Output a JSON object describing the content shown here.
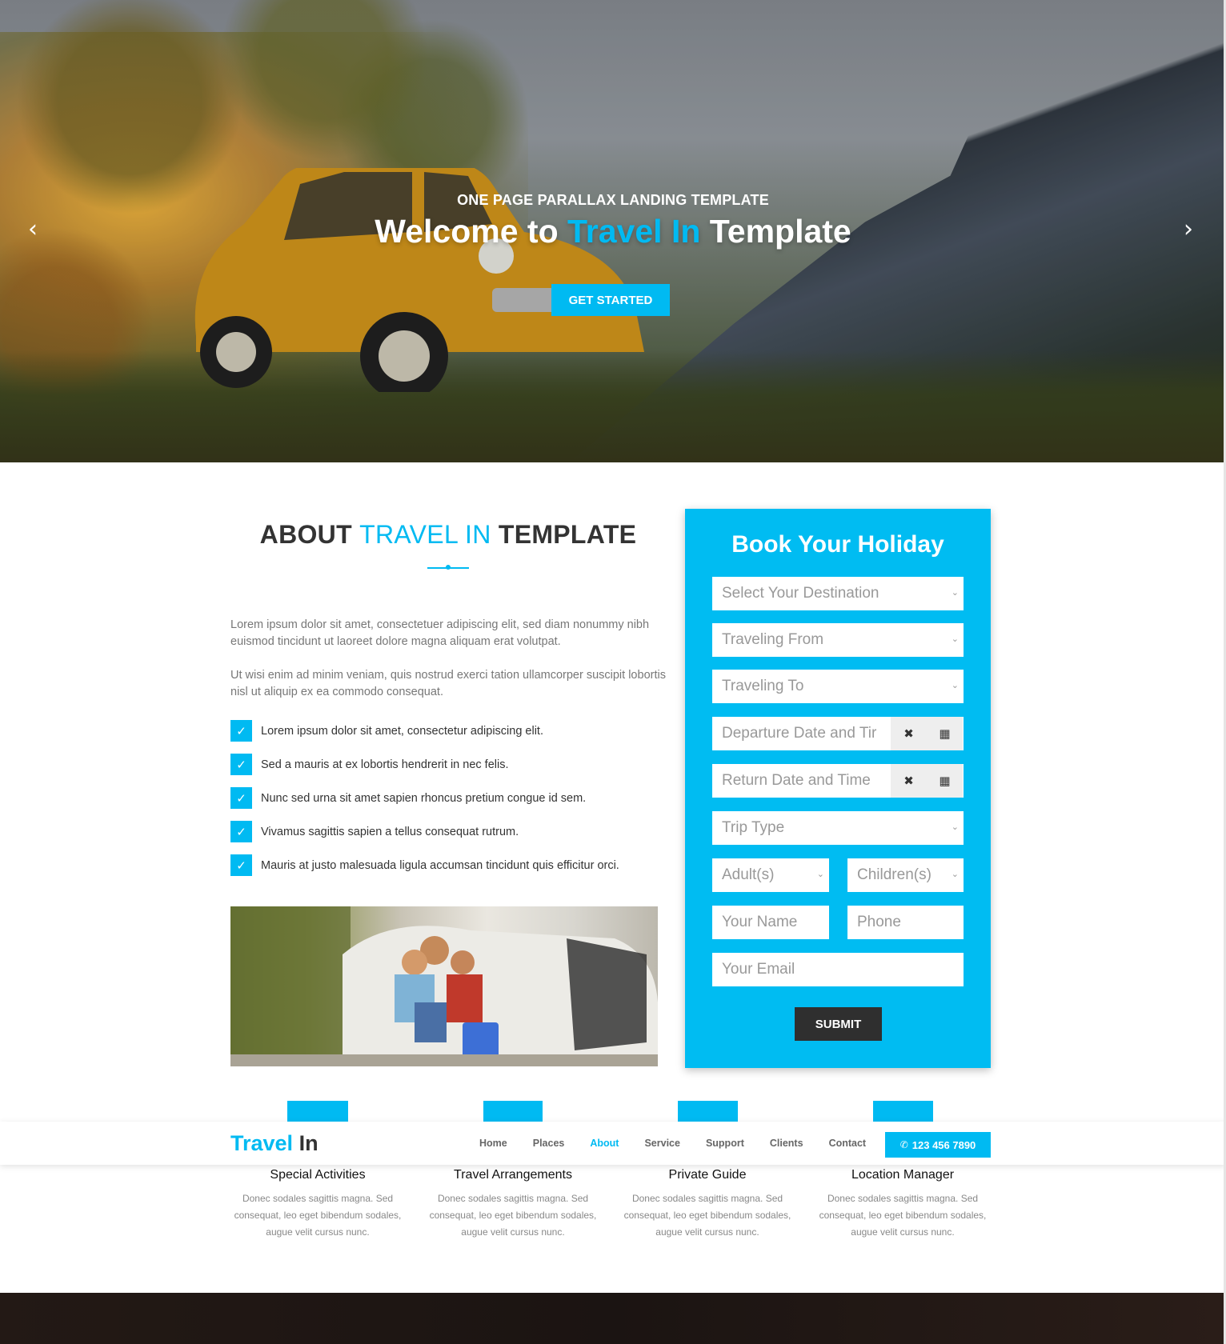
{
  "hero": {
    "subtitle": "ONE PAGE PARALLAX LANDING TEMPLATE",
    "title_prefix": "Welcome to ",
    "title_accent": "Travel In",
    "title_suffix": " Template",
    "cta_label": "GET STARTED",
    "prev_icon": "chevron-left-icon",
    "next_icon": "chevron-right-icon"
  },
  "about": {
    "title_prefix": "ABOUT ",
    "title_accent": "TRAVEL IN",
    "title_suffix": " TEMPLATE",
    "paragraphs": [
      "Lorem ipsum dolor sit amet, consectetuer adipiscing elit, sed diam nonummy nibh euismod tincidunt ut laoreet dolore magna aliquam erat volutpat.",
      "Ut wisi enim ad minim veniam, quis nostrud exerci tation ullamcorper suscipit lobortis nisl ut aliquip ex ea commodo consequat."
    ],
    "checklist": [
      "Lorem ipsum dolor sit amet, consectetur adipiscing elit.",
      "Sed a mauris at ex lobortis hendrerit in nec felis.",
      "Nunc sed urna sit amet sapien rhoncus pretium congue id sem.",
      "Vivamus sagittis sapien a tellus consequat rutrum.",
      "Mauris at justo malesuada ligula accumsan tincidunt quis efficitur orci."
    ]
  },
  "booking": {
    "title": "Book Your Holiday",
    "destination_placeholder": "Select Your Destination",
    "from_placeholder": "Traveling From",
    "to_placeholder": "Traveling To",
    "departure_placeholder": "Departure Date and Tir",
    "return_placeholder": "Return Date and Time",
    "trip_type_placeholder": "Trip Type",
    "adults_placeholder": "Adult(s)",
    "children_placeholder": "Children(s)",
    "name_placeholder": "Your Name",
    "phone_placeholder": "Phone",
    "email_placeholder": "Your Email",
    "submit_label": "SUBMIT"
  },
  "services": [
    {
      "title": "Special Activities",
      "text": "Donec sodales sagittis magna. Sed consequat, leo eget bibendum sodales, augue velit cursus nunc."
    },
    {
      "title": "Travel Arrangements",
      "text": "Donec sodales sagittis magna. Sed consequat, leo eget bibendum sodales, augue velit cursus nunc."
    },
    {
      "title": "Private Guide",
      "text": "Donec sodales sagittis magna. Sed consequat, leo eget bibendum sodales, augue velit cursus nunc."
    },
    {
      "title": "Location Manager",
      "text": "Donec sodales sagittis magna. Sed consequat, leo eget bibendum sodales, augue velit cursus nunc."
    }
  ],
  "navbar": {
    "logo_accent": "Travel",
    "logo_rest": " In",
    "links": [
      "Home",
      "Places",
      "About",
      "Service",
      "Support",
      "Clients",
      "Contact"
    ],
    "active_link": "About",
    "phone_label": "123 456 7890"
  },
  "colors": {
    "accent": "#00baf2",
    "dark_button": "#2f2f2f",
    "text_dark": "#333333",
    "text_muted": "#777777"
  }
}
